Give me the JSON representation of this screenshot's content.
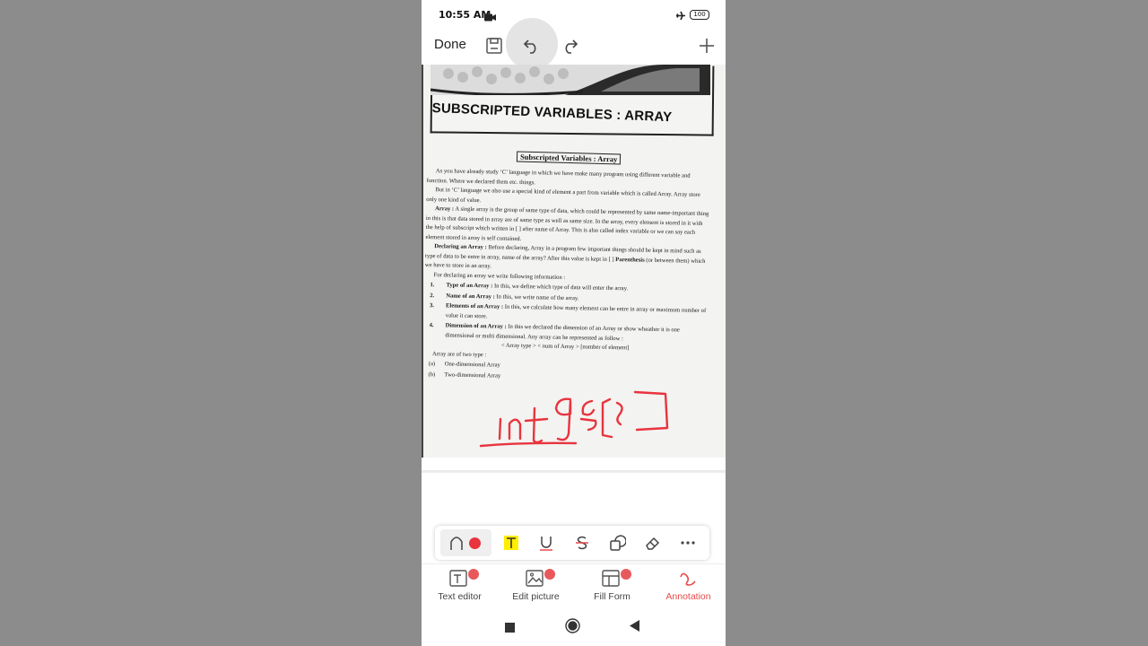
{
  "status_bar": {
    "time": "10:55 AM",
    "battery": "100",
    "icons": [
      "video-camera-icon",
      "airplane-mode-icon",
      "battery-icon"
    ]
  },
  "toolbar": {
    "done_label": "Done",
    "icons": [
      "save-icon",
      "undo-icon",
      "redo-icon",
      "add-icon"
    ]
  },
  "document": {
    "title": "SUBSCRIPTED VARIABLES : ARRAY",
    "heading_box": "Subscripted Variables : Array",
    "para1": "As you have already study ‘C’ language in which we have make many program using different variable and function. Where we declared them etc. things.",
    "para2": "But in ‘C’ language we also use a special kind of element a part from variable which is called Array. Array store only one kind of value.",
    "array_label": "Array :",
    "array_text": " A single array is the group of same type of data, which could be represented by same name-important thing in this is that data stored in array are of same type as well as same size. In the array, every element is stored in it with the help of subscript which written in [ ] after name of Array. This is also called index variable or we can say each element stored in array is self contained.",
    "declaring_label": "Declaring an Array :",
    "declaring_text": " Before declaring, Array in a program few important things should be kept in mind such as type of data to be entre in array, name of the array? After this value is kept in [ ]",
    "parenthesis_label": "Parenthesis",
    "parenthesis_text": " (or between them) which we have to store in an array.",
    "for_declaring": "For declaring an array we write following information :",
    "items": [
      {
        "num": "1.",
        "label": "Type of an Array :",
        "text": " In this, we define which type of data will enter the array."
      },
      {
        "num": "2.",
        "label": "Name of an Array :",
        "text": " In this, we write name of the array."
      },
      {
        "num": "3.",
        "label": "Elements of an Array :",
        "text": " In this, we calculate how many element can be entre in array or maximum number of value it can store."
      },
      {
        "num": "4.",
        "label": "Dimension of an Array :",
        "text": " In this we declared the dimension of an Array or show wheather it is one dimensional or multi dimensional. Any array can be represented as follow :"
      }
    ],
    "syntax": "< Array type > < num of Array > [number of element]",
    "two_types": "Array are of two type :",
    "types": [
      {
        "num": "(a)",
        "text": "One-dimensional Array"
      },
      {
        "num": "(b)",
        "text": "Two-dimensional Array"
      }
    ],
    "annotation_ink": "Int a[]"
  },
  "annotation_toolbar": {
    "pen_color": "#e8343f",
    "highlight_color": "#ffee00",
    "tools": [
      "pen-icon",
      "color-dot-icon",
      "highlight-icon",
      "underline-icon",
      "strikethrough-icon",
      "shapes-icon",
      "eraser-icon",
      "more-icon"
    ]
  },
  "tabs": [
    {
      "label": "Text editor",
      "icon": "text-editor-icon",
      "active": false
    },
    {
      "label": "Edit picture",
      "icon": "edit-picture-icon",
      "active": false
    },
    {
      "label": "Fill Form",
      "icon": "fill-form-icon",
      "active": false
    },
    {
      "label": "Annotation",
      "icon": "annotation-icon",
      "active": true
    }
  ],
  "colors": {
    "accent": "#e84a4a",
    "background": "#8c8c8c",
    "badge": "#e8595c"
  },
  "nav_icons": [
    "recents-icon",
    "home-icon",
    "back-icon"
  ]
}
